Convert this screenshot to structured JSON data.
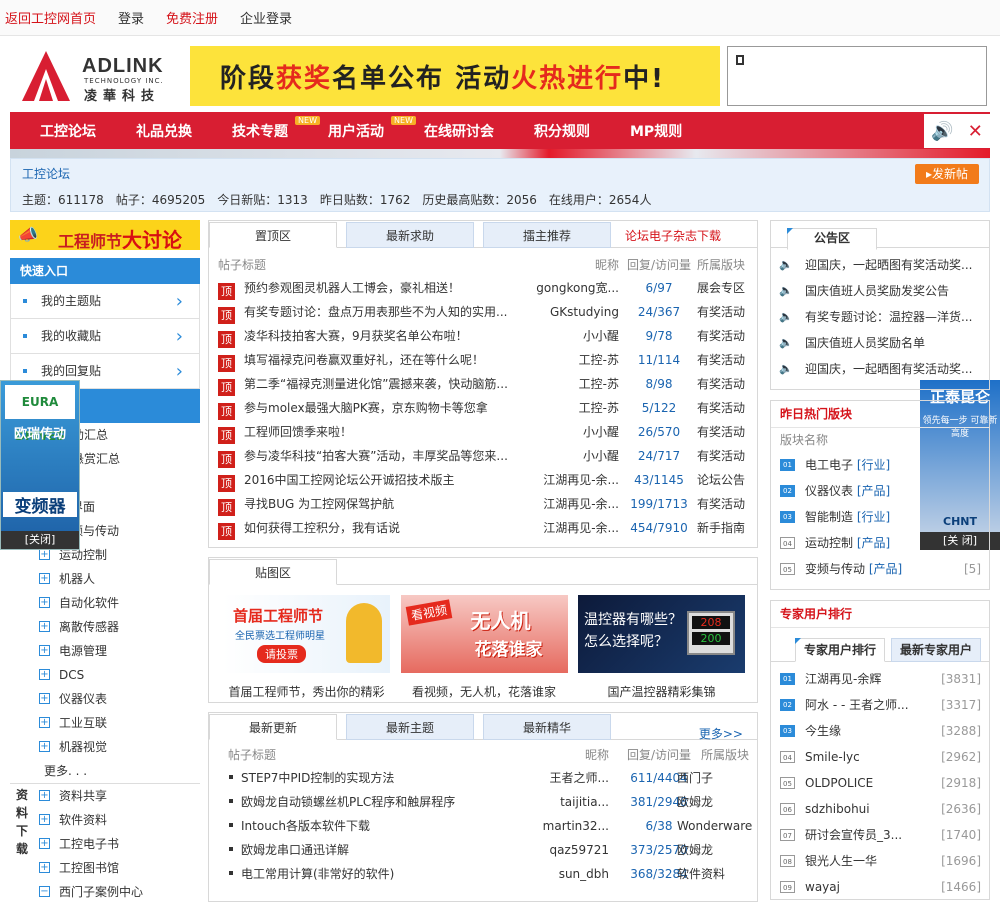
{
  "topbar": {
    "home": "返回工控网首页",
    "login": "登录",
    "register": "免费注册",
    "corp_login": "企业登录"
  },
  "header": {
    "logo_en": "ADLINK",
    "logo_sub": "TECHNOLOGY INC.",
    "logo_cn": "凌華科技",
    "banner_a": "阶段",
    "banner_b": "获奖",
    "banner_c": "名单公布 活动",
    "banner_d": "火热进行",
    "banner_e": "中!"
  },
  "nav": {
    "items": [
      {
        "label": "工控论坛",
        "badge": ""
      },
      {
        "label": "礼品兑换",
        "badge": ""
      },
      {
        "label": "技术专题",
        "badge": "NEW"
      },
      {
        "label": "用户活动",
        "badge": "NEW"
      },
      {
        "label": "在线研讨会",
        "badge": ""
      },
      {
        "label": "积分规则",
        "badge": ""
      },
      {
        "label": "MP规则",
        "badge": ""
      }
    ],
    "sound_icon": "speaker-icon",
    "close_icon": "close-icon"
  },
  "forum": {
    "crumb": "工控论坛",
    "stats": [
      "主题：611178",
      "帖子：4695205",
      "今日新贴：1313",
      "昨日贴数：1762",
      "历史最高贴数：2056",
      "在线用户：2654人"
    ],
    "post_btn": "发新帖"
  },
  "left": {
    "eng_banner_a": "工程师节",
    "eng_banner_b": "大讨论",
    "quick_title": "快速入口",
    "quick_items": [
      "我的主题贴",
      "我的收藏贴",
      "我的回复贴"
    ],
    "partial_items": [
      "助汇总",
      "悬赏汇总"
    ],
    "cats": [
      "机界面",
      "变频与传动",
      "运动控制",
      "机器人",
      "自动化软件",
      "离散传感器",
      "电源管理",
      "DCS",
      "仪器仪表",
      "工业互联",
      "机器视觉"
    ],
    "more": "更多. . .",
    "dl_label": "资料下载",
    "dl_items": [
      "资料共享",
      "软件资料",
      "工控电子书",
      "工控图书馆",
      "西门子案例中心"
    ]
  },
  "ads": {
    "left_brand": "EURA DRIVES",
    "left_title": "欧瑞传动",
    "left_product": "变频器",
    "left_close": "[关闭]",
    "right_title": "正泰昆仑",
    "right_sub": "领先每一步 可靠新高度",
    "right_brand": "CHNT",
    "right_close": "[关 闭]"
  },
  "center": {
    "tabs1": [
      "置顶区",
      "最新求助",
      "擂主推荐"
    ],
    "tab1_link": "论坛电子杂志下载",
    "headers": {
      "title": "帖子标题",
      "author": "昵称",
      "count": "回复/访问量",
      "board": "所属版块"
    },
    "ding": "顶",
    "top_posts": [
      {
        "title": "预约参观图灵机器人工博会，豪礼相送！",
        "author": "gongkong宽...",
        "count": "6/97",
        "board": "展会专区"
      },
      {
        "title": "有奖专题讨论：盘点万用表那些不为人知的实用...",
        "author": "GKstudying",
        "count": "24/367",
        "board": "有奖活动"
      },
      {
        "title": "凌华科技拍客大赛，9月获奖名单公布啦！",
        "author": "小小醒",
        "count": "9/78",
        "board": "有奖活动"
      },
      {
        "title": "填写福禄克问卷赢双重好礼，还在等什么呢！",
        "author": "工控-苏",
        "count": "11/114",
        "board": "有奖活动"
      },
      {
        "title": "第二季“福禄克测量进化馆”震撼来袭，快动脑筋...",
        "author": "工控-苏",
        "count": "8/98",
        "board": "有奖活动"
      },
      {
        "title": "参与molex最强大脑PK赛，京东购物卡等您拿",
        "author": "工控-苏",
        "count": "5/122",
        "board": "有奖活动"
      },
      {
        "title": "工程师回馈季来啦！",
        "author": "小小醒",
        "count": "26/570",
        "board": "有奖活动"
      },
      {
        "title": "参与凌华科技“拍客大赛”活动，丰厚奖品等您来...",
        "author": "小小醒",
        "count": "24/717",
        "board": "有奖活动"
      },
      {
        "title": "2016中国工控网论坛公开诚招技术版主",
        "author": "江湖再见-余...",
        "count": "43/1145",
        "board": "论坛公告"
      },
      {
        "title": "寻找BUG 为工控网保驾护航",
        "author": "江湖再见-余...",
        "count": "199/1713",
        "board": "有奖活动"
      },
      {
        "title": "如何获得工控积分，我有话说",
        "author": "江湖再见-余...",
        "count": "454/7910",
        "board": "新手指南"
      }
    ],
    "pic_tab": "贴图区",
    "pics": [
      {
        "cap": "首届工程师节，秀出你的精彩",
        "title": "首届工程师节",
        "sub": "全民票选工程师明星",
        "btn": "请投票"
      },
      {
        "cap": "看视频，无人机，花落谁家",
        "title": "无人机",
        "sub": "花落谁家",
        "tag": "看视频"
      },
      {
        "cap": "国产温控器精彩集锦",
        "title": "温控器有哪些？",
        "sub": "怎么选择呢？",
        "n1": "208",
        "n2": "200"
      }
    ],
    "tabs2": [
      "最新更新",
      "最新主题",
      "最新精华"
    ],
    "more": "更多>>",
    "new_posts": [
      {
        "title": "STEP7中PID控制的实现方法",
        "author": "王者之师...",
        "count": "611/4404",
        "board": "西门子"
      },
      {
        "title": "欧姆龙自动锁螺丝机PLC程序和触屏程序",
        "author": "taijitia...",
        "count": "381/2948",
        "board": "欧姆龙"
      },
      {
        "title": "Intouch各版本软件下载",
        "author": "martin32...",
        "count": "6/38",
        "board": "Wonderware"
      },
      {
        "title": "欧姆龙串口通迅详解",
        "author": "qaz59721",
        "count": "373/2570",
        "board": "欧姆龙"
      },
      {
        "title": "电工常用计算(非常好的软件)",
        "author": "sun_dbh",
        "count": "368/3284",
        "board": "软件资料"
      }
    ]
  },
  "right": {
    "notice_title": "公告区",
    "notices": [
      "迎国庆，一起晒图有奖活动奖...",
      "国庆值班人员奖励发奖公告",
      "有奖专题讨论：温控器—洋货...",
      "国庆值班人员奖励名单",
      "迎国庆，一起晒图有奖活动奖..."
    ],
    "hot_title": "昨日热门版块",
    "hot_sub": "版块名称",
    "hot": [
      {
        "no": "01",
        "name": "电工电子",
        "type": "[行业]",
        "val": ""
      },
      {
        "no": "02",
        "name": "仪器仪表",
        "type": "[产品]",
        "val": ""
      },
      {
        "no": "03",
        "name": "智能制造",
        "type": "[行业]",
        "val": ""
      },
      {
        "no": "04",
        "name": "运动控制",
        "type": "[产品]",
        "val": ""
      },
      {
        "no": "05",
        "name": "变频与传动",
        "type": "[产品]",
        "val": "[5]"
      }
    ],
    "expert_title": "专家用户排行",
    "expert_tabs": [
      "专家用户排行",
      "最新专家用户"
    ],
    "experts": [
      {
        "no": "01",
        "name": "江湖再见-余辉",
        "val": "[3831]"
      },
      {
        "no": "02",
        "name": "阿水 - - 王者之师...",
        "val": "[3317]"
      },
      {
        "no": "03",
        "name": "今生缘",
        "val": "[3288]"
      },
      {
        "no": "04",
        "name": "Smile-lyc",
        "val": "[2962]"
      },
      {
        "no": "05",
        "name": "OLDPOLICE",
        "val": "[2918]"
      },
      {
        "no": "06",
        "name": "sdzhibohui",
        "val": "[2636]"
      },
      {
        "no": "07",
        "name": "研讨会宣传员_3...",
        "val": "[1740]"
      },
      {
        "no": "08",
        "name": "银光人生一华",
        "val": "[1696]"
      },
      {
        "no": "09",
        "name": "wayaj",
        "val": "[1466]"
      }
    ]
  }
}
